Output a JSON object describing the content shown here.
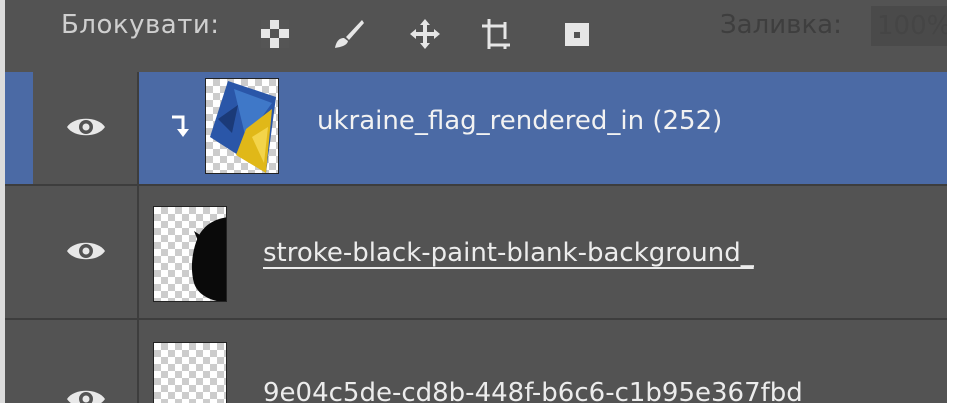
{
  "lock_row": {
    "label": "Блокувати:",
    "fill_label": "Заливка:",
    "fill_value": "100%",
    "buttons": [
      {
        "name": "lock-transparent-pixels-button",
        "icon": "checkerboard-icon"
      },
      {
        "name": "lock-image-pixels-button",
        "icon": "brush-icon"
      },
      {
        "name": "lock-position-button",
        "icon": "move-arrows-icon"
      },
      {
        "name": "lock-artboard-button",
        "icon": "artboard-icon"
      },
      {
        "name": "lock-all-button",
        "icon": "lock-icon"
      }
    ]
  },
  "layers": [
    {
      "name": "ukraine_flag_rendered_in (252)",
      "selected": true,
      "clipped": true,
      "thumbnail": "ukraine-flag-thumbnail"
    },
    {
      "name": "stroke-black-paint-blank-background_",
      "selected": false,
      "clipped": false,
      "thumbnail": "black-paint-stroke-thumbnail"
    },
    {
      "name": "9e04c5de-cd8b-448f-b6c6-c1b95e367fbd",
      "selected": false,
      "clipped": false,
      "thumbnail": "transparent-thumbnail"
    }
  ],
  "colors": {
    "panel_bg": "#535353",
    "selected_layer_bg": "#4b6aa5",
    "text": "#ececec",
    "flag_blue": "#2a56a8",
    "flag_yellow": "#e0b818"
  }
}
